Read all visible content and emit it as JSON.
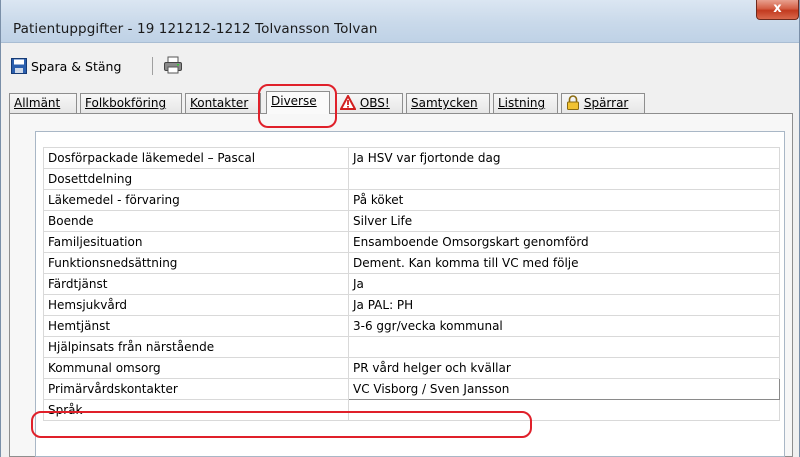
{
  "window": {
    "title": "Patientuppgifter - 19  121212-1212 Tolvansson Tolvan",
    "close_glyph": "x"
  },
  "toolbar": {
    "save_label": "Spara & Stäng"
  },
  "tabs": [
    {
      "label": "Allmänt",
      "active": false
    },
    {
      "label": "Folkbokföring",
      "active": false
    },
    {
      "label": "Kontakter",
      "active": false
    },
    {
      "label": "Diverse",
      "active": true
    },
    {
      "label": "OBS!",
      "active": false,
      "icon": "warning-icon"
    },
    {
      "label": "Samtycken",
      "active": false
    },
    {
      "label": "Listning",
      "active": false
    },
    {
      "label": "Spärrar",
      "active": false,
      "icon": "lock-icon"
    }
  ],
  "rows": [
    {
      "label": "Dosförpackade läkemedel – Pascal",
      "value": "Ja HSV var fjortonde dag"
    },
    {
      "label": "Dosettdelning",
      "value": ""
    },
    {
      "label": "Läkemedel - förvaring",
      "value": "På köket"
    },
    {
      "label": "Boende",
      "value": "Silver Life"
    },
    {
      "label": "Familjesituation",
      "value": "Ensamboende Omsorgskart genomförd"
    },
    {
      "label": "Funktionsnedsättning",
      "value": "Dement. Kan komma till VC med följe"
    },
    {
      "label": "Färdtjänst",
      "value": "Ja"
    },
    {
      "label": "Hemsjukvård",
      "value": "Ja PAL: PH"
    },
    {
      "label": "Hemtjänst",
      "value": "3-6 ggr/vecka kommunal"
    },
    {
      "label": "Hjälpinsats från närstående",
      "value": ""
    },
    {
      "label": "Kommunal omsorg",
      "value": "PR vård helger och kvällar"
    },
    {
      "label": "Primärvårdskontakter",
      "value": "VC Visborg / Sven Jansson"
    },
    {
      "label": "Språk",
      "value": ""
    }
  ],
  "colors": {
    "highlight": "#e0202a",
    "close_button": "#c23a1f"
  }
}
